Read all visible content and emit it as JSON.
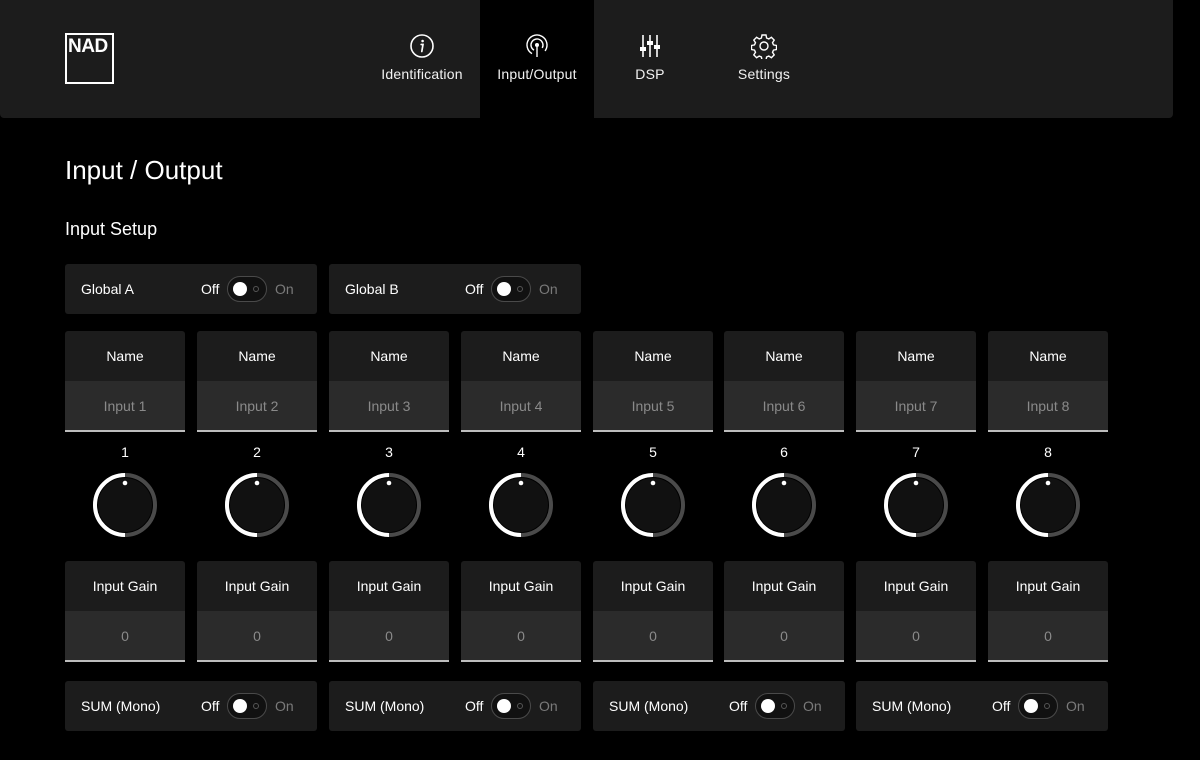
{
  "header": {
    "logo": "NAD",
    "tabs": [
      {
        "label": "Identification",
        "icon": "info-icon"
      },
      {
        "label": "Input/Output",
        "icon": "signal-icon",
        "active": true
      },
      {
        "label": "DSP",
        "icon": "sliders-icon"
      },
      {
        "label": "Settings",
        "icon": "gear-icon"
      }
    ]
  },
  "page": {
    "title": "Input / Output",
    "section": "Input Setup"
  },
  "toggle_text": {
    "off": "Off",
    "on": "On"
  },
  "globals": [
    {
      "label": "Global A",
      "state": "off"
    },
    {
      "label": "Global B",
      "state": "off"
    }
  ],
  "channels": [
    {
      "number": "1",
      "name_header": "Name",
      "name_placeholder": "Input 1",
      "gain_header": "Input Gain",
      "gain_value": "0"
    },
    {
      "number": "2",
      "name_header": "Name",
      "name_placeholder": "Input 2",
      "gain_header": "Input Gain",
      "gain_value": "0"
    },
    {
      "number": "3",
      "name_header": "Name",
      "name_placeholder": "Input 3",
      "gain_header": "Input Gain",
      "gain_value": "0"
    },
    {
      "number": "4",
      "name_header": "Name",
      "name_placeholder": "Input 4",
      "gain_header": "Input Gain",
      "gain_value": "0"
    },
    {
      "number": "5",
      "name_header": "Name",
      "name_placeholder": "Input 5",
      "gain_header": "Input Gain",
      "gain_value": "0"
    },
    {
      "number": "6",
      "name_header": "Name",
      "name_placeholder": "Input 6",
      "gain_header": "Input Gain",
      "gain_value": "0"
    },
    {
      "number": "7",
      "name_header": "Name",
      "name_placeholder": "Input 7",
      "gain_header": "Input Gain",
      "gain_value": "0"
    },
    {
      "number": "8",
      "name_header": "Name",
      "name_placeholder": "Input 8",
      "gain_header": "Input Gain",
      "gain_value": "0"
    }
  ],
  "sum_mono": [
    {
      "label": "SUM (Mono)",
      "state": "off"
    },
    {
      "label": "SUM (Mono)",
      "state": "off"
    },
    {
      "label": "SUM (Mono)",
      "state": "off"
    },
    {
      "label": "SUM (Mono)",
      "state": "off"
    }
  ],
  "colors": {
    "background": "#000000",
    "panel": "#1c1c1c",
    "field": "#2b2b2b",
    "accent": "#ffffff"
  }
}
